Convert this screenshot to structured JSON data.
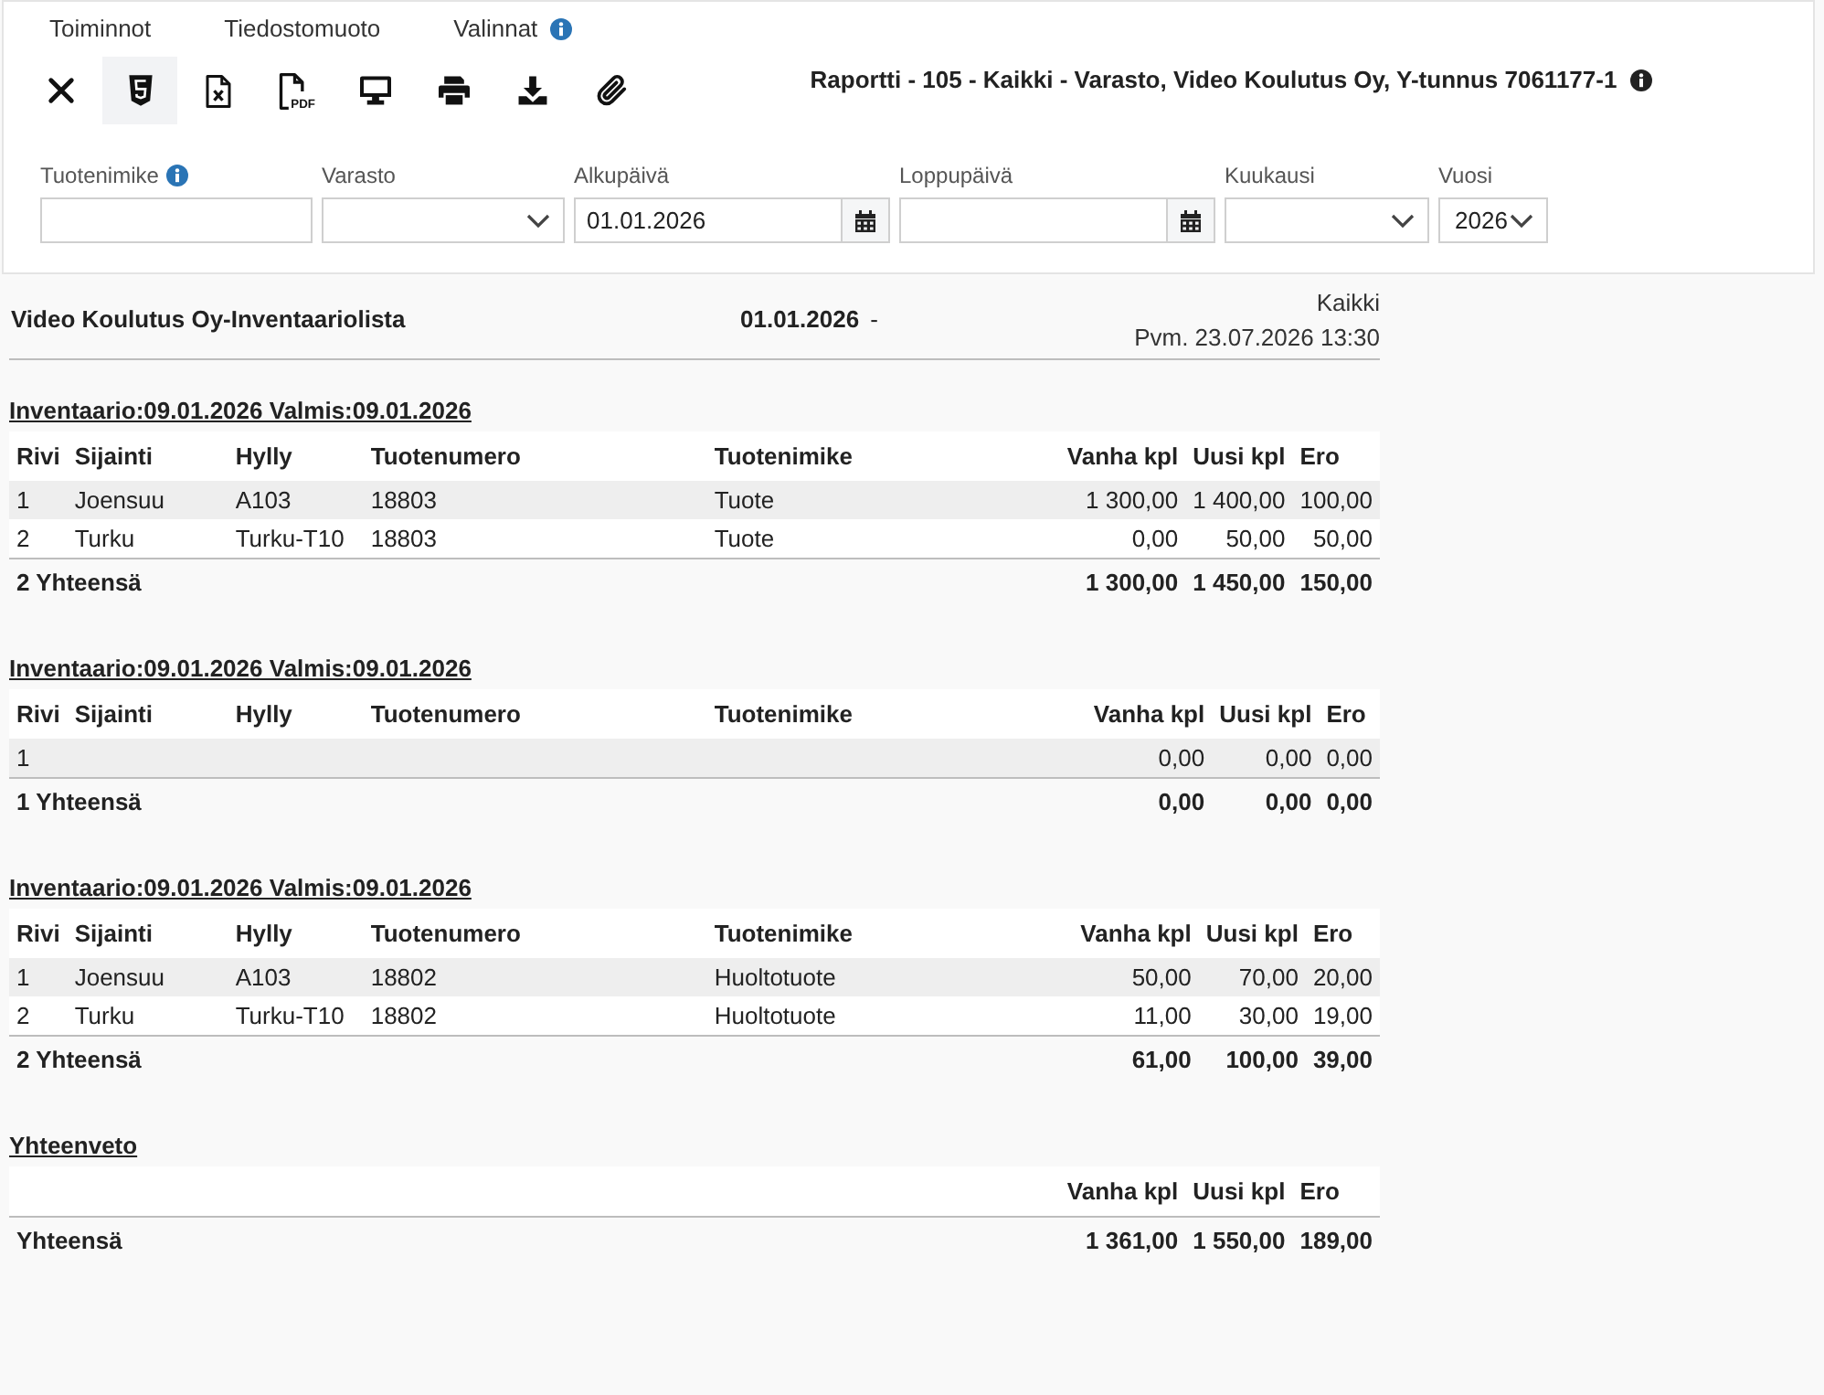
{
  "menu": [
    {
      "label": "Toiminnot",
      "has_info": false
    },
    {
      "label": "Tiedostomuoto",
      "has_info": false
    },
    {
      "label": "Valinnat",
      "has_info": true
    }
  ],
  "toolbar": [
    {
      "kind": "close",
      "selected": false
    },
    {
      "kind": "html",
      "selected": true
    },
    {
      "kind": "spreadsheet",
      "selected": false
    },
    {
      "kind": "pdf",
      "selected": false,
      "badge": "PDF"
    },
    {
      "kind": "screen",
      "selected": false
    },
    {
      "kind": "print",
      "selected": false
    },
    {
      "kind": "download",
      "selected": false
    },
    {
      "kind": "attach",
      "selected": false
    }
  ],
  "report_title": {
    "text": "Raportti - 105 - Kaikki - Varasto, Video Koulutus Oy, Y-tunnus 7061177-1",
    "has_info": true
  },
  "filters": [
    {
      "label": "Tuotenimike",
      "kind": "text",
      "has_info": true
    },
    {
      "label": "Varasto",
      "kind": "select",
      "has_info": false
    },
    {
      "label": "Alkupäivä",
      "kind": "date",
      "has_info": false,
      "value": "01.01.2026"
    },
    {
      "label": "Loppupäivä",
      "kind": "date",
      "has_info": false
    },
    {
      "label": "Kuukausi",
      "kind": "select",
      "has_info": false
    },
    {
      "label": "Vuosi",
      "kind": "select",
      "has_info": false,
      "value": "2026"
    }
  ],
  "report": {
    "title": "Video Koulutus Oy-Inventaariolista",
    "date_from": "01.01.2026",
    "range_separator": "-",
    "scope": "Kaikki",
    "printed": "Pvm. 23.07.2026 13:30"
  },
  "sections": [
    {
      "heading": "Inventaario:09.01.2026 Valmis:09.01.2026",
      "columns": [
        "Rivi",
        "Sijainti",
        "Hylly",
        "Tuotenumero",
        "Tuotenimike"
      ],
      "quantity_columns": [
        "Vanha kpl",
        "Uusi kpl",
        "Ero"
      ],
      "rows": [
        {
          "cells": [
            "1",
            "Joensuu",
            "A103",
            "18803",
            "Tuote"
          ],
          "quantities": [
            "1 300,00",
            "1 400,00",
            "100,00"
          ]
        },
        {
          "cells": [
            "2",
            "Turku",
            "Turku-T10",
            "18803",
            "Tuote"
          ],
          "quantities": [
            "0,00",
            "50,00",
            "50,00"
          ]
        }
      ],
      "total": {
        "label": "2 Yhteensä",
        "values": [
          "1 300,00",
          "1 450,00",
          "150,00"
        ]
      }
    },
    {
      "heading": "Inventaario:09.01.2026 Valmis:09.01.2026",
      "columns": [
        "Rivi",
        "Sijainti",
        "Hylly",
        "Tuotenumero",
        "Tuotenimike"
      ],
      "quantity_columns": [
        "Vanha kpl",
        "Uusi kpl",
        "Ero"
      ],
      "rows": [
        {
          "cells": [
            "1",
            null,
            null,
            null,
            null
          ],
          "quantities": [
            "0,00",
            "0,00",
            "0,00"
          ]
        }
      ],
      "total": {
        "label": "1 Yhteensä",
        "values": [
          "0,00",
          "0,00",
          "0,00"
        ]
      }
    },
    {
      "heading": "Inventaario:09.01.2026 Valmis:09.01.2026",
      "columns": [
        "Rivi",
        "Sijainti",
        "Hylly",
        "Tuotenumero",
        "Tuotenimike"
      ],
      "quantity_columns": [
        "Vanha kpl",
        "Uusi kpl",
        "Ero"
      ],
      "rows": [
        {
          "cells": [
            "1",
            "Joensuu",
            "A103",
            "18802",
            "Huoltotuote"
          ],
          "quantities": [
            "50,00",
            "70,00",
            "20,00"
          ]
        },
        {
          "cells": [
            "2",
            "Turku",
            "Turku-T10",
            "18802",
            "Huoltotuote"
          ],
          "quantities": [
            "11,00",
            "30,00",
            "19,00"
          ]
        }
      ],
      "total": {
        "label": "2 Yhteensä",
        "values": [
          "61,00",
          "100,00",
          "39,00"
        ]
      }
    }
  ],
  "summary": {
    "heading": "Yhteenveto",
    "quantity_columns": [
      "Vanha kpl",
      "Uusi kpl",
      "Ero"
    ],
    "total": {
      "label": "Yhteensä",
      "values": [
        "1 361,00",
        "1 550,00",
        "189,00"
      ]
    }
  }
}
